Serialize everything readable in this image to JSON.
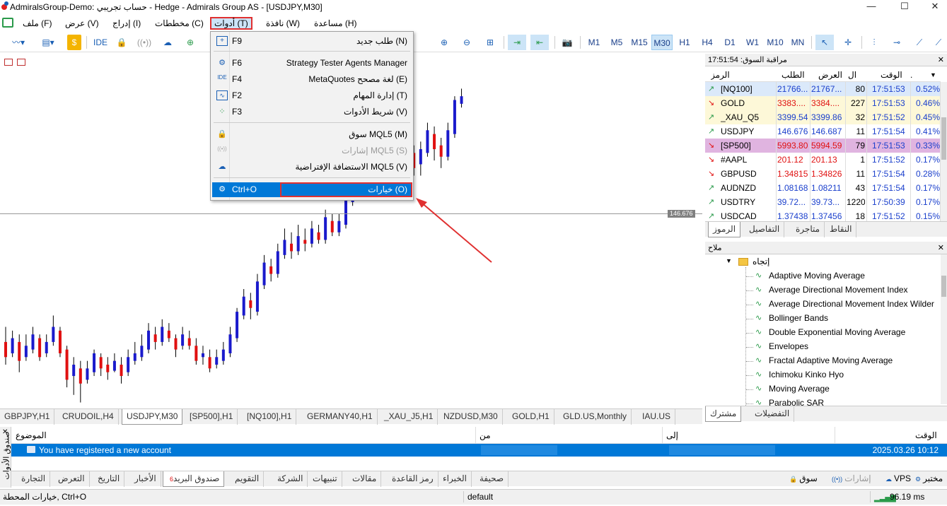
{
  "window": {
    "title": "AdmiralsGroup-Demo: حساب تجريبي - Hedge - Admirals Group AS - [USDJPY,M30]",
    "minimize": "—",
    "maximize": "☐",
    "close": "✕"
  },
  "menu": {
    "items": [
      "ملف (F)",
      "عرض (V)",
      "إدراج (I)",
      "مخططات (C)",
      "أدوات (T)",
      "نافذة (W)",
      "مساعدة (H)"
    ],
    "active": "أدوات (T)"
  },
  "toolbar": {
    "ide": "IDE",
    "timeframes": [
      "M1",
      "M5",
      "M15",
      "M30",
      "H1",
      "H4",
      "D1",
      "W1",
      "M10",
      "MN"
    ],
    "selected_timeframe": "M30"
  },
  "tools_menu": {
    "items": [
      {
        "label": "طلب جديد (N)",
        "shortcut": "F9",
        "icon": "new-order-icon"
      },
      {
        "label": "Strategy Tester Agents Manager",
        "shortcut": "F6",
        "icon": "agents-icon"
      },
      {
        "label": "MetaQuotes لغة مصحح (E)",
        "shortcut": "F4",
        "icon": "ide-icon"
      },
      {
        "label": "إدارة المهام (T)",
        "shortcut": "F2",
        "icon": "task-manager-icon"
      },
      {
        "label": "شريط الأدوات (V)",
        "shortcut": "F3",
        "icon": "toolbar-icon"
      },
      {
        "label": "سوق MQL5 (M)",
        "shortcut": "",
        "icon": "market-icon"
      },
      {
        "label": "إشارات MQL5 (S)",
        "shortcut": "",
        "icon": "signals-icon"
      },
      {
        "label": "الاستضافة الإفتراضية MQL5 (V)",
        "shortcut": "",
        "icon": "vps-icon"
      },
      {
        "label": "خيارات (O)",
        "shortcut": "Ctrl+O",
        "icon": "gear-icon"
      }
    ]
  },
  "chart": {
    "price_label": "146.676",
    "tabs": [
      "GBPJPY,H1",
      "CRUDOIL,H4",
      "USDJPY,M30",
      "[SP500],H1",
      "[NQ100],H1",
      "GERMANY40,H1",
      "_XAU_J5,H1",
      "NZDUSD,M30",
      "GOLD,H1",
      "GLD.US,Monthly",
      "IAU.US"
    ],
    "selected_tab": "USDJPY,M30"
  },
  "market_watch": {
    "title": "مراقبة السوق: 17:51:54",
    "headers": {
      "symbol": "الرمز",
      "bid": "الطلب",
      "ask": "العرض",
      "spread": "ال",
      "time": "الوقت",
      "change": "."
    },
    "rows": [
      {
        "symbol": "[NQ100]",
        "bid": "21766...",
        "ask": "21767...",
        "spread": "80",
        "time": "17:51:53",
        "change": "0.52%",
        "dir": "up",
        "bg": "#dbe9fa"
      },
      {
        "symbol": "GOLD",
        "bid": "3383....",
        "ask": "3384....",
        "spread": "227",
        "time": "17:51:53",
        "change": "0.46%",
        "dir": "down",
        "bg": "#fdf8d8"
      },
      {
        "symbol": "_XAU_Q5",
        "bid": "3399.54",
        "ask": "3399.86",
        "spread": "32",
        "time": "17:51:52",
        "change": "0.45%",
        "dir": "up",
        "bg": "#fdf8d8"
      },
      {
        "symbol": "USDJPY",
        "bid": "146.676",
        "ask": "146.687",
        "spread": "11",
        "time": "17:51:54",
        "change": "0.41%",
        "dir": "up",
        "bg": "#ffffff"
      },
      {
        "symbol": "[SP500]",
        "bid": "5993.80",
        "ask": "5994.59",
        "spread": "79",
        "time": "17:51:53",
        "change": "0.33%",
        "dir": "down",
        "bg": "#e0b4e0"
      },
      {
        "symbol": "#AAPL",
        "bid": "201.12",
        "ask": "201.13",
        "spread": "1",
        "time": "17:51:52",
        "change": "0.17%",
        "dir": "down",
        "bg": "#ffffff"
      },
      {
        "symbol": "GBPUSD",
        "bid": "1.34815",
        "ask": "1.34826",
        "spread": "11",
        "time": "17:51:54",
        "change": "0.28%",
        "dir": "down",
        "bg": "#ffffff"
      },
      {
        "symbol": "AUDNZD",
        "bid": "1.08168",
        "ask": "1.08211",
        "spread": "43",
        "time": "17:51:54",
        "change": "0.17%",
        "dir": "up",
        "bg": "#ffffff"
      },
      {
        "symbol": "USDTRY",
        "bid": "39.72...",
        "ask": "39.73...",
        "spread": "1220",
        "time": "17:50:39",
        "change": "0.17%",
        "dir": "up",
        "bg": "#ffffff"
      },
      {
        "symbol": "USDCAD",
        "bid": "1.37438",
        "ask": "1.37456",
        "spread": "18",
        "time": "17:51:52",
        "change": "0.15%",
        "dir": "up",
        "bg": "#ffffff"
      }
    ],
    "tabs": [
      "الرموز",
      "التفاصيل",
      "متاجرة",
      "النقاط"
    ],
    "selected_tab": "الرموز"
  },
  "navigator": {
    "title": "ملاح",
    "folder": "إتجاه",
    "items": [
      "Adaptive Moving Average",
      "Average Directional Movement Index",
      "Average Directional Movement Index Wilder",
      "Bollinger Bands",
      "Double Exponential Moving Average",
      "Envelopes",
      "Fractal Adaptive Moving Average",
      "Ichimoku Kinko Hyo",
      "Moving Average",
      "Parabolic SAR"
    ],
    "tabs": [
      "مشترك",
      "التفضيلات"
    ],
    "selected_tab": "مشترك"
  },
  "toolbox": {
    "side_label": "صندوق الأدوات",
    "headers": {
      "subject": "الموضوع",
      "from": "من",
      "to": "إلى",
      "time": "الوقت"
    },
    "row": {
      "subject": "You have registered a new account",
      "time": "2025.03.26 10:12"
    },
    "tabs": [
      "التجارة",
      "التعرض",
      "التاريخ",
      "الأخبار",
      "صندوق البريد",
      "التقويم",
      "الشركة",
      "تنبيهات",
      "مقالات",
      "رمز القاعدة",
      "الخبراء",
      "صحيفة"
    ],
    "mailbox_badge": "6",
    "selected_tab": "صندوق البريد",
    "right_tabs": [
      "سوق",
      "إشارات",
      "VPS",
      "مختبر"
    ]
  },
  "status": {
    "left": "خيارات المحطة, Ctrl+O",
    "profile": "default",
    "ping": "96.19 ms"
  },
  "colors": {
    "accent": "#0078d7",
    "bull": "#1a1acc",
    "bear": "#e01010",
    "highlight_box": "#e03030"
  },
  "candles": [
    [
      1.1,
      0.9,
      1.3,
      0.8
    ],
    [
      0.95,
      1.15,
      1.25,
      0.9
    ],
    [
      1.1,
      0.85,
      1.2,
      0.7
    ],
    [
      0.9,
      1.05,
      1.2,
      0.85
    ],
    [
      1.0,
      1.2,
      1.3,
      0.95
    ],
    [
      1.15,
      0.9,
      1.2,
      0.85
    ],
    [
      0.95,
      1.1,
      1.2,
      0.9
    ],
    [
      1.1,
      1.3,
      1.45,
      1.05
    ],
    [
      1.25,
      0.95,
      1.3,
      0.9
    ],
    [
      1.0,
      0.6,
      1.05,
      0.5
    ],
    [
      0.65,
      0.8,
      0.9,
      0.4
    ],
    [
      0.75,
      0.55,
      0.85,
      0.3
    ],
    [
      0.6,
      0.75,
      0.85,
      0.55
    ],
    [
      0.7,
      0.95,
      1.0,
      0.65
    ],
    [
      0.9,
      0.75,
      0.95,
      0.65
    ],
    [
      0.8,
      0.7,
      0.9,
      0.6
    ],
    [
      0.72,
      0.85,
      0.95,
      0.7
    ],
    [
      0.8,
      0.65,
      0.9,
      0.55
    ],
    [
      0.7,
      0.9,
      1.0,
      0.65
    ],
    [
      0.85,
      0.95,
      1.1,
      0.8
    ],
    [
      0.9,
      1.05,
      1.2,
      0.85
    ],
    [
      1.0,
      1.25,
      1.35,
      0.95
    ],
    [
      1.2,
      1.1,
      1.3,
      1.0
    ],
    [
      1.1,
      1.3,
      1.4,
      1.05
    ],
    [
      1.25,
      1.15,
      1.35,
      1.1
    ],
    [
      1.15,
      1.0,
      1.2,
      0.9
    ],
    [
      1.05,
      1.2,
      1.3,
      1.0
    ],
    [
      1.15,
      1.05,
      1.25,
      1.0
    ],
    [
      1.05,
      0.85,
      1.15,
      0.8
    ],
    [
      0.9,
      0.95,
      1.05,
      0.8
    ],
    [
      0.9,
      0.75,
      1.0,
      0.7
    ],
    [
      0.8,
      0.9,
      1.0,
      0.75
    ],
    [
      0.85,
      1.0,
      1.1,
      0.8
    ],
    [
      0.95,
      1.2,
      1.3,
      0.9
    ],
    [
      1.15,
      1.5,
      1.55,
      1.1
    ],
    [
      1.45,
      1.7,
      1.8,
      1.4
    ],
    [
      1.65,
      1.55,
      1.75,
      1.4
    ],
    [
      1.5,
      1.9,
      2.0,
      1.45
    ],
    [
      1.85,
      2.15,
      2.25,
      1.8
    ],
    [
      2.1,
      2.0,
      2.2,
      1.9
    ],
    [
      2.0,
      2.3,
      2.4,
      1.95
    ],
    [
      2.25,
      2.45,
      2.6,
      2.2
    ],
    [
      2.4,
      2.3,
      2.55,
      2.2
    ],
    [
      2.3,
      2.5,
      2.65,
      2.25
    ],
    [
      2.45,
      2.4,
      2.6,
      2.3
    ],
    [
      2.4,
      2.6,
      2.7,
      2.35
    ],
    [
      2.55,
      2.45,
      2.65,
      2.4
    ],
    [
      2.45,
      2.75,
      2.85,
      2.4
    ],
    [
      2.7,
      2.55,
      2.8,
      2.5
    ],
    [
      2.55,
      2.7,
      2.8,
      2.5
    ],
    [
      2.65,
      3.0,
      3.1,
      2.6
    ],
    [
      2.95,
      3.35,
      3.45,
      2.9
    ],
    [
      3.3,
      3.7,
      3.8,
      3.25
    ],
    [
      3.65,
      3.5,
      3.75,
      3.4
    ],
    [
      3.5,
      3.75,
      3.85,
      3.45
    ],
    [
      3.75,
      4.4,
      4.5,
      3.7
    ],
    [
      4.35,
      4.2,
      4.45,
      4.1
    ],
    [
      4.2,
      4.1,
      4.3,
      3.9
    ],
    [
      4.1,
      3.8,
      4.15,
      3.7
    ],
    [
      3.85,
      3.6,
      3.95,
      3.45
    ],
    [
      3.6,
      3.4,
      3.7,
      3.3
    ],
    [
      3.45,
      3.65,
      3.75,
      3.3
    ],
    [
      3.6,
      3.9,
      4.0,
      3.55
    ],
    [
      3.85,
      3.65,
      3.95,
      3.5
    ],
    [
      3.7,
      3.55,
      3.8,
      3.4
    ],
    [
      3.55,
      3.9,
      4.0,
      3.5
    ],
    [
      3.85,
      4.3,
      4.35,
      3.8
    ],
    [
      4.25,
      4.35,
      4.45,
      4.2
    ]
  ]
}
